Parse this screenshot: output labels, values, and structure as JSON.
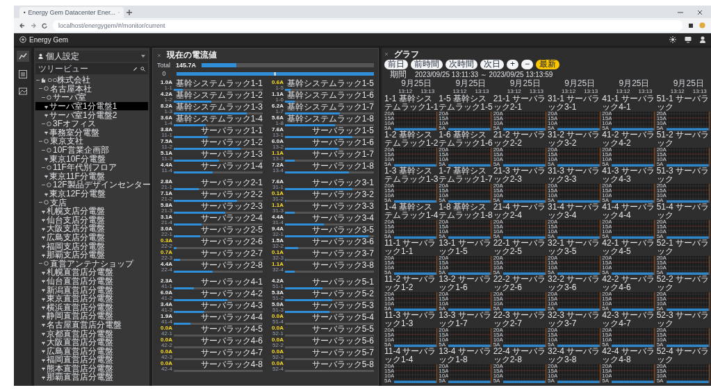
{
  "browser": {
    "tab_title": "Energy Gem Datacenter Ener...",
    "address": "localhost/energygem/#/monitor/current"
  },
  "app": {
    "title": "Energy Gem"
  },
  "sidebar": {
    "profile": "個人設定",
    "tree_title": "ツリービュー",
    "tree": [
      {
        "label": "○○株式会社",
        "kind": "company",
        "expanded": true,
        "children": [
          {
            "label": "名古屋本社",
            "kind": "group",
            "expanded": true,
            "children": [
              {
                "label": "サーバ室",
                "kind": "group",
                "expanded": true,
                "children": [
                  {
                    "label": "サーバ室1分電盤1",
                    "kind": "panel",
                    "selected": true
                  },
                  {
                    "label": "サーバ室1分電盤2",
                    "kind": "panel",
                    "selected": false
                  }
                ]
              },
              {
                "label": "3Fオフィス",
                "kind": "group",
                "expanded": true,
                "children": [
                  {
                    "label": "事務室分電盤",
                    "kind": "panel",
                    "selected": false
                  }
                ]
              }
            ]
          },
          {
            "label": "東京支社",
            "kind": "group",
            "expanded": true,
            "children": [
              {
                "label": "10F営業企画部",
                "kind": "group",
                "expanded": true,
                "children": [
                  {
                    "label": "東京10F分電盤",
                    "kind": "panel",
                    "selected": false
                  }
                ]
              },
              {
                "label": "11F年代別フロア",
                "kind": "group",
                "expanded": true,
                "children": [
                  {
                    "label": "東京11F分電盤",
                    "kind": "panel",
                    "selected": false
                  }
                ]
              },
              {
                "label": "12F製品デザインセンター",
                "kind": "group",
                "expanded": true,
                "children": [
                  {
                    "label": "東京12F分電盤",
                    "kind": "panel",
                    "selected": false
                  }
                ]
              }
            ]
          },
          {
            "label": "支店",
            "kind": "group",
            "expanded": true,
            "children": [
              {
                "label": "札幌支店分電盤",
                "kind": "panel",
                "selected": false
              },
              {
                "label": "仙台支店分電盤",
                "kind": "panel",
                "selected": false
              },
              {
                "label": "大阪支店分電盤",
                "kind": "panel",
                "selected": false
              },
              {
                "label": "広島支店分電盤",
                "kind": "panel",
                "selected": false
              },
              {
                "label": "福岡支店分電盤",
                "kind": "panel",
                "selected": false
              },
              {
                "label": "那覇支店分電盤",
                "kind": "panel",
                "selected": false
              }
            ]
          },
          {
            "label": "直営アンテナショップ",
            "kind": "group",
            "expanded": true,
            "children": [
              {
                "label": "札幌直営店分電盤",
                "kind": "panel",
                "selected": false
              },
              {
                "label": "仙台直営店分電盤",
                "kind": "panel",
                "selected": false
              },
              {
                "label": "新潟直営店分電盤",
                "kind": "panel",
                "selected": false
              },
              {
                "label": "東京直営店分電盤",
                "kind": "panel",
                "selected": false
              },
              {
                "label": "横浜直営店分電盤",
                "kind": "panel",
                "selected": false
              },
              {
                "label": "静岡直営店分電盤",
                "kind": "panel",
                "selected": false
              },
              {
                "label": "名古屋直営店分電盤",
                "kind": "panel",
                "selected": false
              },
              {
                "label": "京都直営店分電盤",
                "kind": "panel",
                "selected": false
              },
              {
                "label": "大阪直営店分電盤",
                "kind": "panel",
                "selected": false
              },
              {
                "label": "広島直営店分電盤",
                "kind": "panel",
                "selected": false
              },
              {
                "label": "福岡直営店分電盤",
                "kind": "panel",
                "selected": false
              },
              {
                "label": "熊本直営店分電盤",
                "kind": "panel",
                "selected": false
              },
              {
                "label": "那覇直営店分電盤",
                "kind": "panel",
                "selected": false
              }
            ]
          }
        ]
      }
    ]
  },
  "current_panel": {
    "title": "現在の電流値",
    "total": {
      "label": "Total",
      "value": "145.7A",
      "level": 0.2
    },
    "scale": {
      "label": "0"
    },
    "sections": [
      {
        "items": [
          {
            "value": "1.0A",
            "alert": false,
            "circuit": "1-1",
            "name": "基幹システムラック1-1",
            "level": 0.1
          },
          {
            "value": "0.6A",
            "alert": true,
            "circuit": "1-5",
            "name": "基幹システムラック1-5",
            "level": 0.06
          },
          {
            "value": "4.2A",
            "alert": false,
            "circuit": "1-2",
            "name": "基幹システムラック1-2",
            "level": 0.42
          },
          {
            "value": "1.1A",
            "alert": false,
            "circuit": "1-6",
            "name": "基幹システムラック1-6",
            "level": 0.11
          },
          {
            "value": "8.2A",
            "alert": false,
            "circuit": "1-3",
            "name": "基幹システムラック1-3",
            "level": 0.82
          },
          {
            "value": "6.2A",
            "alert": false,
            "circuit": "1-7",
            "name": "基幹システムラック1-7",
            "level": 0.62
          },
          {
            "value": "3.6A",
            "alert": false,
            "circuit": "1-4",
            "name": "基幹システムラック1-4",
            "level": 0.36
          },
          {
            "value": "5.6A",
            "alert": false,
            "circuit": "1-8",
            "name": "基幹システムラック1-8",
            "level": 0.56
          },
          {
            "value": "3.8A",
            "alert": false,
            "circuit": "11-1",
            "name": "サーバラック1-1",
            "level": 0.38
          },
          {
            "value": "7.6A",
            "alert": false,
            "circuit": "13-1",
            "name": "サーバラック1-5",
            "level": 0.76
          },
          {
            "value": "7.5A",
            "alert": false,
            "circuit": "11-2",
            "name": "サーバラック1-2",
            "level": 0.75
          },
          {
            "value": "6.0A",
            "alert": false,
            "circuit": "13-2",
            "name": "サーバラック1-6",
            "level": 0.6
          },
          {
            "value": "5.1A",
            "alert": false,
            "circuit": "11-3",
            "name": "サーバラック1-3",
            "level": 0.51
          },
          {
            "value": "1.1A",
            "alert": true,
            "circuit": "13-3",
            "name": "サーバラック1-7",
            "level": 0.11
          },
          {
            "value": "4.4A",
            "alert": false,
            "circuit": "11-4",
            "name": "サーバラック1-4",
            "level": 0.44
          },
          {
            "value": "7.2A",
            "alert": false,
            "circuit": "13-4",
            "name": "サーバラック1-8",
            "level": 0.72
          }
        ]
      },
      {
        "items": [
          {
            "value": "2.8A",
            "alert": false,
            "circuit": "21-1",
            "name": "サーバラック2-1",
            "level": 0.28
          },
          {
            "value": "7.6A",
            "alert": false,
            "circuit": "31-1",
            "name": "サーバラック3-1",
            "level": 0.76
          },
          {
            "value": "7.1A",
            "alert": false,
            "circuit": "21-2",
            "name": "サーバラック2-2",
            "level": 0.71
          },
          {
            "value": "0.1A",
            "alert": true,
            "circuit": "31-2",
            "name": "サーバラック3-2",
            "level": 0.01
          },
          {
            "value": "5.8A",
            "alert": false,
            "circuit": "21-3",
            "name": "サーバラック2-3",
            "level": 0.58
          },
          {
            "value": "1.1A",
            "alert": true,
            "circuit": "31-3",
            "name": "サーバラック3-3",
            "level": 0.11
          },
          {
            "value": "3.1A",
            "alert": false,
            "circuit": "21-4",
            "name": "サーバラック2-4",
            "level": 0.31
          },
          {
            "value": "4.4A",
            "alert": false,
            "circuit": "31-4",
            "name": "サーバラック3-4",
            "level": 0.44
          },
          {
            "value": "3.0A",
            "alert": false,
            "circuit": "22-1",
            "name": "サーバラック2-5",
            "level": 0.3
          },
          {
            "value": "9.4A",
            "alert": false,
            "circuit": "32-1",
            "name": "サーバラック3-5",
            "level": 0.94
          },
          {
            "value": "0.3A",
            "alert": true,
            "circuit": "22-2",
            "name": "サーバラック2-6",
            "level": 0.03
          },
          {
            "value": "1.5A",
            "alert": false,
            "circuit": "32-2",
            "name": "サーバラック3-6",
            "level": 0.15
          },
          {
            "value": "0.7A",
            "alert": true,
            "circuit": "22-3",
            "name": "サーバラック2-7",
            "level": 0.07
          },
          {
            "value": "0.1A",
            "alert": true,
            "circuit": "32-3",
            "name": "サーバラック3-7",
            "level": 0.01
          },
          {
            "value": "4.4A",
            "alert": false,
            "circuit": "22-4",
            "name": "サーバラック2-8",
            "level": 0.44
          },
          {
            "value": "1.1A",
            "alert": true,
            "circuit": "32-4",
            "name": "サーバラック3-8",
            "level": 0.11
          }
        ]
      },
      {
        "items": [
          {
            "value": "2.3A",
            "alert": false,
            "circuit": "41-1",
            "name": "サーバラック4-1",
            "level": 0.23
          },
          {
            "value": "4.2A",
            "alert": false,
            "circuit": "51-1",
            "name": "サーバラック5-1",
            "level": 0.42
          },
          {
            "value": "6.0A",
            "alert": false,
            "circuit": "41-2",
            "name": "サーバラック4-2",
            "level": 0.6
          },
          {
            "value": "5.3A",
            "alert": false,
            "circuit": "51-2",
            "name": "サーバラック5-2",
            "level": 0.53
          },
          {
            "value": "3.4A",
            "alert": false,
            "circuit": "41-3",
            "name": "サーバラック4-3",
            "level": 0.34
          },
          {
            "value": "5.0A",
            "alert": false,
            "circuit": "51-3",
            "name": "サーバラック5-3",
            "level": 0.5
          },
          {
            "value": "1.9A",
            "alert": false,
            "circuit": "41-4",
            "name": "サーバラック4-4",
            "level": 0.19
          },
          {
            "value": "0.0A",
            "alert": true,
            "circuit": "51-4",
            "name": "サーバラック5-4",
            "level": 0
          },
          {
            "value": "0.0A",
            "alert": true,
            "circuit": "42-1",
            "name": "サーバラック4-5",
            "level": 0
          },
          {
            "value": "0.0A",
            "alert": true,
            "circuit": "52-1",
            "name": "サーバラック5-5",
            "level": 0
          },
          {
            "value": "0.0A",
            "alert": true,
            "circuit": "42-2",
            "name": "サーバラック4-6",
            "level": 0
          },
          {
            "value": "0.0A",
            "alert": true,
            "circuit": "52-2",
            "name": "サーバラック5-6",
            "level": 0
          },
          {
            "value": "0.0A",
            "alert": true,
            "circuit": "42-3",
            "name": "サーバラック4-7",
            "level": 0
          },
          {
            "value": "0.0A",
            "alert": true,
            "circuit": "52-3",
            "name": "サーバラック5-7",
            "level": 0
          },
          {
            "value": "0.0A",
            "alert": true,
            "circuit": "42-4",
            "name": "サーバラック4-8",
            "level": 0
          },
          {
            "value": "0.0A",
            "alert": true,
            "circuit": "52-4",
            "name": "サーバラック5-8",
            "level": 0
          }
        ]
      }
    ]
  },
  "graph_panel": {
    "title": "グラフ",
    "buttons": [
      {
        "label": "前日",
        "highlight": false
      },
      {
        "label": "前時間",
        "highlight": false
      },
      {
        "label": "次時間",
        "highlight": false
      },
      {
        "label": "次日",
        "highlight": false
      },
      {
        "label": "+",
        "highlight": false
      },
      {
        "label": "−",
        "highlight": false
      },
      {
        "label": "最新",
        "highlight": true
      }
    ],
    "period_label": "期間",
    "period": "2023/09/25 13:11:33 ～ 2023/09/25 13:13:59",
    "columns": [
      {
        "date": "9月25日",
        "times": [
          "13:12",
          "13:13"
        ],
        "charts": [
          {
            "title": "1-1 基幹システムラック1-1",
            "ticks": [
              "20A",
              "15A",
              "10A",
              "5A"
            ]
          },
          {
            "title": "1-2 基幹システムラック1-2",
            "ticks": [
              "20A",
              "15A",
              "10A",
              "5A"
            ]
          },
          {
            "title": "1-3 基幹システムラック1-3",
            "ticks": [
              "20A",
              "15A",
              "10A",
              "5A"
            ]
          },
          {
            "title": "1-4 基幹システムラック1-4",
            "ticks": [
              "20A",
              "15A",
              "10A",
              "5A"
            ]
          },
          {
            "title": "11-1 サーバラック1-1",
            "ticks": [
              "20A",
              "15A",
              "10A",
              "5A"
            ]
          },
          {
            "title": "11-2 サーバラック1-2",
            "ticks": [
              "20A",
              "15A",
              "10A",
              "5A"
            ]
          },
          {
            "title": "11-3 サーバラック1-3",
            "ticks": [
              "20A",
              "15A",
              "10A",
              "5A"
            ]
          },
          {
            "title": "11-4 サーバラック1-4",
            "ticks": [
              "20A",
              "15A",
              "10A",
              "5A"
            ]
          }
        ]
      },
      {
        "date": "9月25日",
        "times": [
          "13:12",
          "13:13"
        ],
        "charts": [
          {
            "title": "1-5 基幹システムラック1-5",
            "ticks": [
              "20A",
              "15A",
              "10A",
              "5A"
            ]
          },
          {
            "title": "1-6 基幹システムラック1-6",
            "ticks": [
              "20A",
              "15A",
              "10A",
              "5A"
            ]
          },
          {
            "title": "1-7 基幹システムラック1-7",
            "ticks": [
              "20A",
              "15A",
              "10A",
              "5A"
            ]
          },
          {
            "title": "1-8 基幹システムラック1-8",
            "ticks": [
              "20A",
              "15A",
              "10A",
              "5A"
            ]
          },
          {
            "title": "13-1 サーバラック1-5",
            "ticks": [
              "20A",
              "15A",
              "10A",
              "5A"
            ]
          },
          {
            "title": "13-2 サーバラック1-6",
            "ticks": [
              "20A",
              "15A",
              "10A",
              "5A"
            ]
          },
          {
            "title": "13-3 サーバラック1-7",
            "ticks": [
              "20A",
              "15A",
              "10A",
              "5A"
            ]
          },
          {
            "title": "13-4 サーバラック1-8",
            "ticks": [
              "20A",
              "15A",
              "10A",
              "5A"
            ]
          }
        ]
      },
      {
        "date": "9月25日",
        "times": [
          "13:12",
          "13:13"
        ],
        "charts": [
          {
            "title": "21-1 サーバラック2-1",
            "ticks": [
              "20A",
              "15A",
              "10A",
              "5A"
            ]
          },
          {
            "title": "21-2 サーバラック2-2",
            "ticks": [
              "20A",
              "15A",
              "10A",
              "5A"
            ]
          },
          {
            "title": "21-3 サーバラック2-3",
            "ticks": [
              "20A",
              "15A",
              "10A",
              "5A"
            ]
          },
          {
            "title": "21-4 サーバラック2-4",
            "ticks": [
              "20A",
              "15A",
              "10A",
              "5A"
            ]
          },
          {
            "title": "22-1 サーバラック2-5",
            "ticks": [
              "20A",
              "15A",
              "10A",
              "5A"
            ]
          },
          {
            "title": "22-2 サーバラック2-6",
            "ticks": [
              "20A",
              "15A",
              "10A",
              "5A"
            ]
          },
          {
            "title": "22-3 サーバラック2-7",
            "ticks": [
              "20A",
              "15A",
              "10A",
              "5A"
            ]
          },
          {
            "title": "22-4 サーバラック2-8",
            "ticks": [
              "20A",
              "15A",
              "10A",
              "5A"
            ]
          }
        ]
      },
      {
        "date": "9月25日",
        "times": [
          "13:12",
          "13:13"
        ],
        "charts": [
          {
            "title": "31-1 サーバラック3-1",
            "ticks": [
              "20A",
              "15A",
              "10A",
              "5A"
            ]
          },
          {
            "title": "31-2 サーバラック3-2",
            "ticks": [
              "20A",
              "15A",
              "10A",
              "5A"
            ]
          },
          {
            "title": "31-3 サーバラック3-3",
            "ticks": [
              "20A",
              "15A",
              "10A",
              "5A"
            ]
          },
          {
            "title": "31-4 サーバラック3-4",
            "ticks": [
              "20A",
              "15A",
              "10A",
              "5A"
            ]
          },
          {
            "title": "32-1 サーバラック3-5",
            "ticks": [
              "20A",
              "15A",
              "10A",
              "5A"
            ]
          },
          {
            "title": "32-2 サーバラック3-6",
            "ticks": [
              "20A",
              "15A",
              "10A",
              "5A"
            ]
          },
          {
            "title": "32-3 サーバラック3-7",
            "ticks": [
              "20A",
              "15A",
              "10A",
              "5A"
            ]
          },
          {
            "title": "32-4 サーバラック3-8",
            "ticks": [
              "20A",
              "15A",
              "10A",
              "5A"
            ]
          }
        ]
      },
      {
        "date": "9月25日",
        "times": [
          "13:12",
          "13:13"
        ],
        "charts": [
          {
            "title": "41-1 サーバラック4-1",
            "ticks": [
              "20A",
              "15A",
              "10A",
              "5A"
            ]
          },
          {
            "title": "41-2 サーバラック4-2",
            "ticks": [
              "20A",
              "15A",
              "10A",
              "5A"
            ]
          },
          {
            "title": "41-3 サーバラック4-3",
            "ticks": [
              "20A",
              "15A",
              "10A",
              "5A"
            ]
          },
          {
            "title": "41-4 サーバラック4-4",
            "ticks": [
              "20A",
              "15A",
              "10A",
              "5A"
            ]
          },
          {
            "title": "42-1 サーバラック4-5",
            "ticks": [
              "20A",
              "15A",
              "10A",
              "5A"
            ]
          },
          {
            "title": "42-2 サーバラック4-6",
            "ticks": [
              "20A",
              "15A",
              "10A",
              "5A"
            ]
          },
          {
            "title": "42-3 サーバラック4-7",
            "ticks": [
              "20A",
              "15A",
              "10A",
              "5A"
            ]
          },
          {
            "title": "42-4 サーバラック4-8",
            "ticks": [
              "20A",
              "15A",
              "10A",
              "5A"
            ]
          }
        ]
      },
      {
        "date": "9月25日",
        "times": [
          "13:12",
          "13:13"
        ],
        "charts": [
          {
            "title": "51-1 サーバラック",
            "ticks": [
              "20A",
              "15A",
              "10A",
              "5A"
            ]
          },
          {
            "title": "51-2 サーバラック",
            "ticks": [
              "20A",
              "15A",
              "10A",
              "5A"
            ]
          },
          {
            "title": "51-3 サーバラック",
            "ticks": [
              "20A",
              "15A",
              "10A",
              "5A"
            ]
          },
          {
            "title": "51-4 サーバラック",
            "ticks": [
              "20A",
              "15A",
              "10A",
              "5A"
            ]
          },
          {
            "title": "52-1 サーバラック",
            "ticks": [
              "20A",
              "15A",
              "10A",
              "5A"
            ]
          },
          {
            "title": "52-2 サーバラック",
            "ticks": [
              "20A",
              "15A",
              "10A",
              "5A"
            ]
          },
          {
            "title": "52-3 サーバラック",
            "ticks": [
              "20A",
              "15A",
              "10A",
              "5A"
            ]
          },
          {
            "title": "52-4 サーバラック",
            "ticks": [
              "20A",
              "15A",
              "10A",
              "5A"
            ]
          }
        ]
      }
    ]
  }
}
